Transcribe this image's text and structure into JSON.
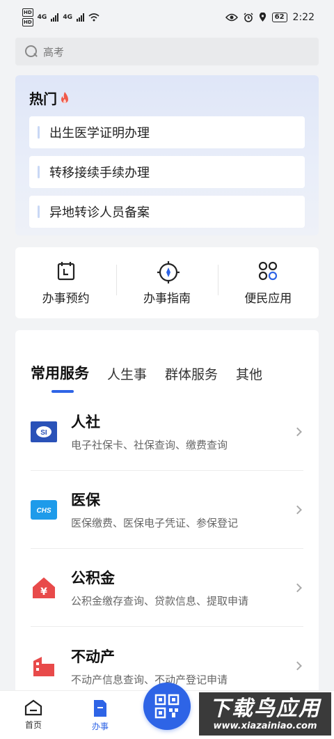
{
  "status_bar": {
    "hd1": "HD",
    "hd2": "HD",
    "net1": "4G",
    "net2": "4G",
    "battery": "62",
    "time": "2:22"
  },
  "search": {
    "placeholder": "高考"
  },
  "hot": {
    "title": "热门",
    "items": [
      {
        "label": "出生医学证明办理"
      },
      {
        "label": "转移接续手续办理"
      },
      {
        "label": "异地转诊人员备案"
      }
    ]
  },
  "quick_actions": [
    {
      "label": "办事预约",
      "icon": "calendar-icon"
    },
    {
      "label": "办事指南",
      "icon": "compass-icon"
    },
    {
      "label": "便民应用",
      "icon": "apps-grid-icon"
    }
  ],
  "tabs": [
    {
      "label": "常用服务",
      "active": true
    },
    {
      "label": "人生事",
      "active": false
    },
    {
      "label": "群体服务",
      "active": false
    },
    {
      "label": "其他",
      "active": false
    }
  ],
  "services": [
    {
      "title": "人社",
      "desc": "电子社保卡、社保查询、缴费查询",
      "icon": "social-security-icon"
    },
    {
      "title": "医保",
      "desc": "医保缴费、医保电子凭证、参保登记",
      "icon": "chs-medical-insurance-icon"
    },
    {
      "title": "公积金",
      "desc": "公积金缴存查询、贷款信息、提取申请",
      "icon": "housing-fund-icon"
    },
    {
      "title": "不动产",
      "desc": "不动产信息查询、不动产登记申请",
      "icon": "real-estate-icon"
    }
  ],
  "bottom_nav": [
    {
      "label": "首页",
      "icon": "home-icon",
      "active": false
    },
    {
      "label": "办事",
      "icon": "document-icon",
      "active": true
    }
  ],
  "watermark": {
    "title": "下载鸟应用",
    "url": "www.xiazainiao.com"
  },
  "colors": {
    "accent": "#2e64e6",
    "red": "#e84a4a",
    "hot_bg": "#e4eaf8"
  }
}
